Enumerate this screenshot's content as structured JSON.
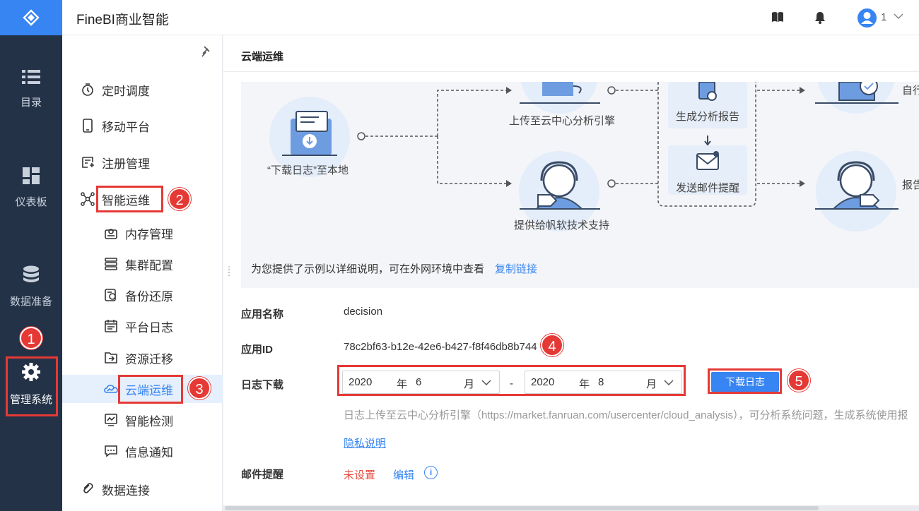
{
  "app": {
    "title": "FineBI商业智能"
  },
  "rail": {
    "items": [
      {
        "label": "目录",
        "icon": "list-icon"
      },
      {
        "label": "仪表板",
        "icon": "dashboard-icon"
      },
      {
        "label": "数据准备",
        "icon": "database-icon"
      },
      {
        "label": "管理系统",
        "icon": "gear-icon"
      }
    ]
  },
  "topbar": {
    "user": "1"
  },
  "subnav": {
    "items": [
      {
        "label": "定时调度",
        "icon": "timer-icon"
      },
      {
        "label": "移动平台",
        "icon": "mobile-icon"
      },
      {
        "label": "注册管理",
        "icon": "register-icon"
      },
      {
        "label": "智能运维",
        "icon": "network-icon"
      },
      {
        "label": "内存管理",
        "icon": "memory-icon"
      },
      {
        "label": "集群配置",
        "icon": "cluster-icon"
      },
      {
        "label": "备份还原",
        "icon": "backup-icon"
      },
      {
        "label": "平台日志",
        "icon": "log-icon"
      },
      {
        "label": "资源迁移",
        "icon": "migrate-icon"
      },
      {
        "label": "云端运维",
        "icon": "cloud-ops-icon"
      },
      {
        "label": "智能检测",
        "icon": "monitor-icon"
      },
      {
        "label": "信息通知",
        "icon": "message-icon"
      },
      {
        "label": "数据连接",
        "icon": "link-icon"
      }
    ]
  },
  "page": {
    "title": "云端运维"
  },
  "flow": {
    "download_local": "“下载日志”至本地",
    "upload_cloud": "上传至云中心分析引擎",
    "generate_report": "生成分析报告",
    "send_mail": "发送邮件提醒",
    "tech_support": "提供给帆软技术支持",
    "right_top": "自行",
    "right_bottom": "报告",
    "note": "为您提供了示例以详细说明，可在外网环境中查看",
    "copy_link": "复制链接"
  },
  "form": {
    "app_name_label": "应用名称",
    "app_name": "decision",
    "app_id_label": "应用ID",
    "app_id": "78c2bf63-b12e-42e6-b427-f8f46db8b744",
    "log_download_label": "日志下载",
    "from_year": "2020",
    "from_month": "6",
    "to_year": "2020",
    "to_month": "8",
    "year_unit": "年",
    "month_unit": "月",
    "range_sep": "-",
    "download_button": "下载日志",
    "hint": "日志上传至云中心分析引擎（https://market.fanruan.com/usercenter/cloud_analysis），可分析系统问题，生成系统使用报",
    "privacy": "隐私说明",
    "mail_label": "邮件提醒",
    "mail_status": "未设置",
    "edit": "编辑",
    "info": "i"
  },
  "annotations": [
    "1",
    "2",
    "3",
    "4",
    "5"
  ],
  "colors": {
    "accent": "#3685f2",
    "rail": "#243248",
    "annotation": "#e53935"
  }
}
